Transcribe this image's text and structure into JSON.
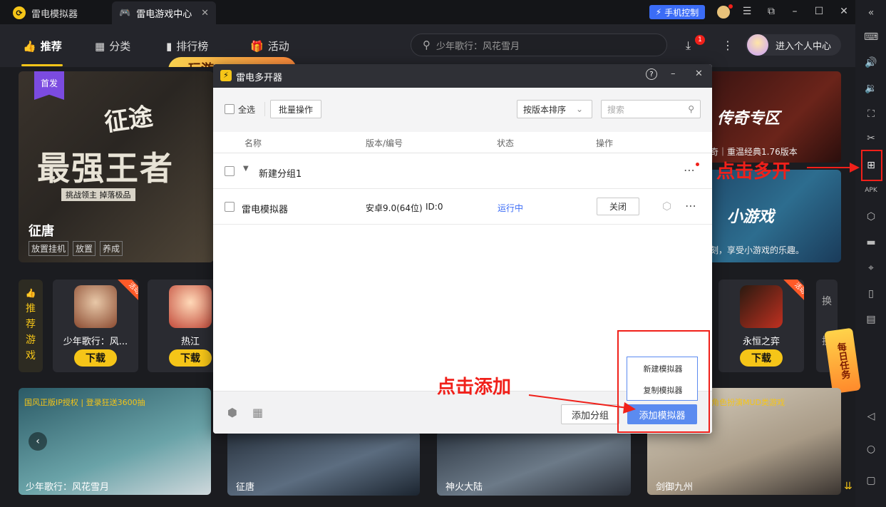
{
  "titlebar": {
    "tab1": "雷电模拟器",
    "tab2": "雷电游戏中心",
    "phone_control": "手机控制"
  },
  "nav": {
    "items": [
      "推荐",
      "分类",
      "排行榜",
      "活动"
    ],
    "search_placeholder": "少年歌行：风花雪月",
    "download_badge": "1",
    "user_center": "进入个人中心",
    "promo_chip": "玩游"
  },
  "banners": {
    "first_badge": "首发",
    "main_title_art": "最强王者",
    "main_subtitle_art": "挑战领主  掉落极品",
    "main_logo": "征途",
    "main_game": "征唐",
    "main_tags": [
      "放置挂机",
      "放置",
      "养成"
    ],
    "right_top_title": "传奇专区",
    "right_top_caption": "奇｜重温经典1.76版本",
    "right_bottom_title": "小游戏",
    "right_bottom_caption": "刻，享受小游戏的乐趣。"
  },
  "recommend": {
    "side_label": [
      "推",
      "荐",
      "游",
      "戏"
    ],
    "activity_ribbon": "活动",
    "games": [
      {
        "name": "少年歌行：风...",
        "button": "下载"
      },
      {
        "name": "热江",
        "button": "下载"
      },
      {
        "name": "永恒之弈",
        "button": "下载"
      }
    ],
    "swap_label": [
      "换",
      "换"
    ],
    "daily_task": "每日任务"
  },
  "bottom_cards": [
    {
      "caption": "少年歌行：风花雪月",
      "tagline": "国风正版IP授权 | 登录狂送3600抽"
    },
    {
      "caption": "征唐"
    },
    {
      "caption": "神火大陆"
    },
    {
      "caption": "剑御九州",
      "tagline": "角色扮演MUD类游戏"
    }
  ],
  "dialog": {
    "title": "雷电多开器",
    "select_all": "全选",
    "batch": "批量操作",
    "sort": "按版本排序",
    "search_placeholder": "搜索",
    "columns": [
      "名称",
      "版本/编号",
      "状态",
      "操作"
    ],
    "group_name": "新建分组1",
    "instance": {
      "name": "雷电模拟器",
      "version": "安卓9.0(64位)",
      "id": "ID:0",
      "status": "运行中",
      "close": "关闭"
    },
    "add_group": "添加分组",
    "add_emulator": "添加模拟器",
    "popup_new": "新建模拟器",
    "popup_copy": "复制模拟器"
  },
  "annotations": {
    "multi_open": "点击多开",
    "add": "点击添加"
  },
  "colors": {
    "accent": "#f5c518",
    "blue": "#3b6cf6",
    "annotation": "#f0201a",
    "running": "#3b6cf6"
  }
}
